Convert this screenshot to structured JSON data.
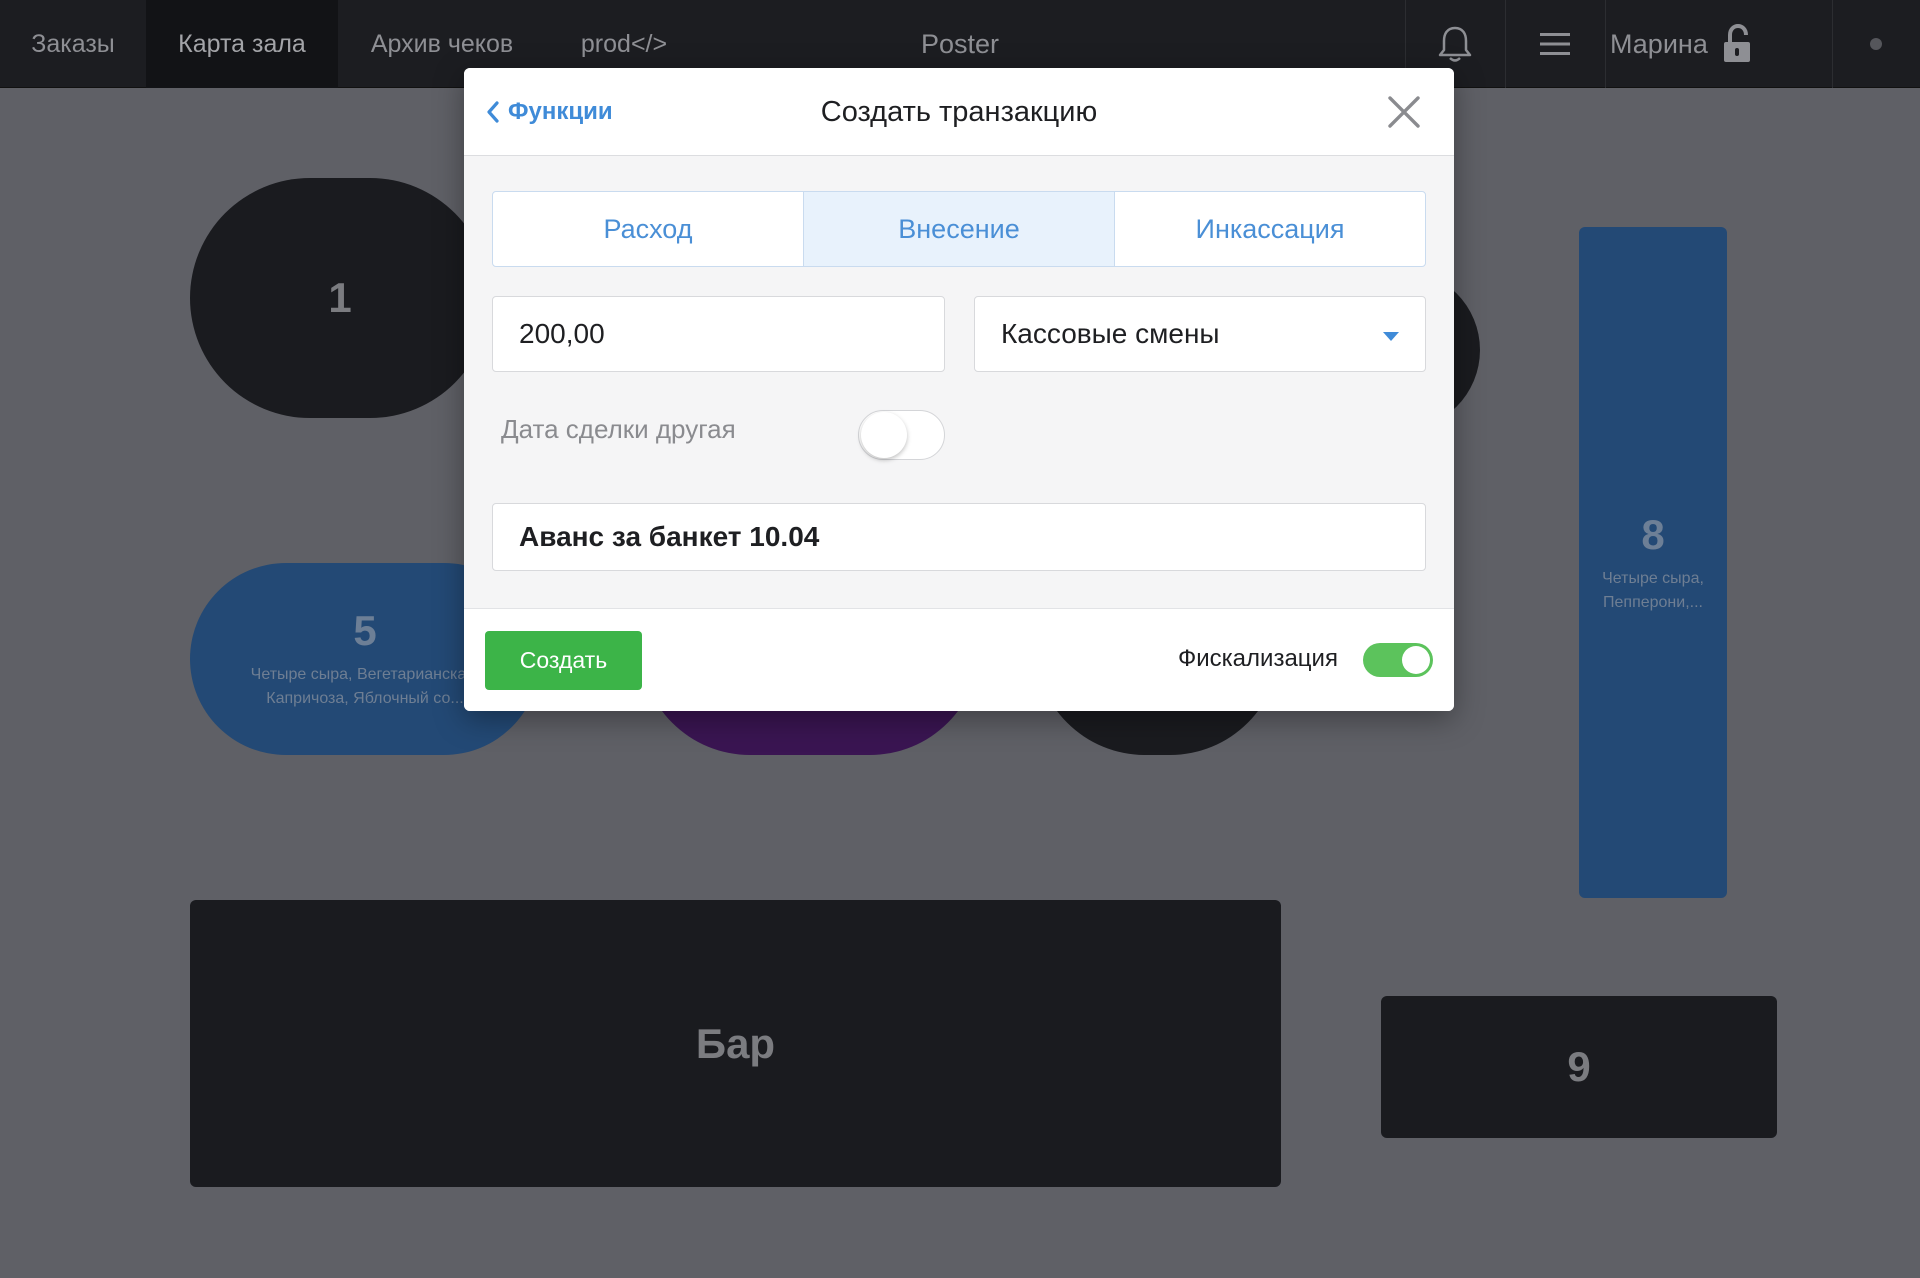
{
  "topbar": {
    "tabs": [
      {
        "label": "Заказы"
      },
      {
        "label": "Карта зала"
      },
      {
        "label": "Архив чеков"
      },
      {
        "label": "prod</>"
      }
    ],
    "title": "Poster",
    "user": "Марина"
  },
  "hall": {
    "table_1": {
      "number": "1"
    },
    "table_5": {
      "number": "5",
      "items": "Четыре сыра, Вегетарианская, Капричоза, Яблочный со..."
    },
    "table_8": {
      "number": "8",
      "items": "Четыре сыра, Пепперони,..."
    },
    "table_9": {
      "number": "9"
    },
    "bar": {
      "label": "Бар"
    }
  },
  "modal": {
    "back_label": "Функции",
    "title": "Создать транзакцию",
    "segments": [
      {
        "label": "Расход",
        "active": false
      },
      {
        "label": "Внесение",
        "active": true
      },
      {
        "label": "Инкассация",
        "active": false
      }
    ],
    "amount": "200,00",
    "category": "Кассовые смены",
    "other_date_label": "Дата сделки другая",
    "other_date_enabled": false,
    "comment": "Аванс за банкет 10.04",
    "create_label": "Создать",
    "fiscal_label": "Фискализация",
    "fiscal_enabled": true
  },
  "colors": {
    "accent": "#3f8bd8",
    "create_button": "#3cb448",
    "toggle_on": "#5cc35c",
    "table_blue": "#234975",
    "table_purple": "#3a1552",
    "table_dark": "#1a1b1f"
  }
}
